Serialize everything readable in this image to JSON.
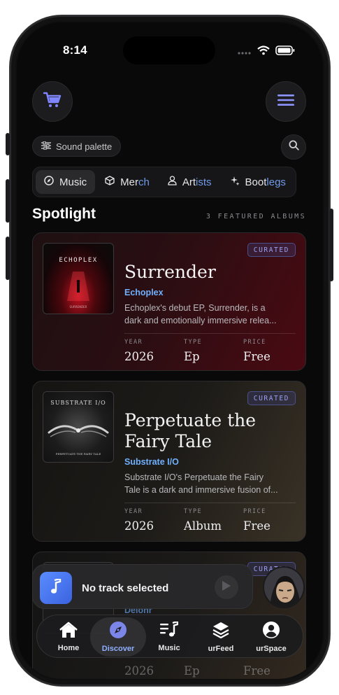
{
  "status": {
    "time": "8:14"
  },
  "header": {
    "cart_icon": "cart-icon",
    "menu_icon": "menu-icon"
  },
  "filter": {
    "label": "Sound palette",
    "search_icon": "search-icon"
  },
  "tabs": [
    {
      "name": "Music",
      "prefix": "Music",
      "suffix": "",
      "icon": "compass-icon",
      "active": true
    },
    {
      "name": "Merch",
      "prefix": "Mer",
      "suffix": "ch",
      "icon": "box-icon",
      "active": false
    },
    {
      "name": "Artists",
      "prefix": "Art",
      "suffix": "ists",
      "icon": "person-icon",
      "active": false
    },
    {
      "name": "Bootlegs",
      "prefix": "Boot",
      "suffix": "legs",
      "icon": "sparkle-icon",
      "active": false
    }
  ],
  "spotlight": {
    "title": "Spotlight",
    "meta": "3 FEATURED ALBUMS"
  },
  "albums": [
    {
      "badge": "CURATED",
      "title": "Surrender",
      "artist": "Echoplex",
      "desc_line1": "Echoplex's debut EP, Surrender, is a",
      "desc_line2": "dark and emotionally immersive relea...",
      "cover_text": "ECHOPLEX",
      "cover_sub": "SURRENDER",
      "year_label": "YEAR",
      "year": "2026",
      "type_label": "TYPE",
      "type": "Ep",
      "price_label": "PRICE",
      "price": "Free"
    },
    {
      "badge": "CURATED",
      "title_line1": "Perpetuate the",
      "title_line2": "Fairy Tale",
      "artist": "Substrate I/O",
      "desc_line1": "Substrate I/O's Perpetuate the Fairy",
      "desc_line2": "Tale is a dark and immersive fusion of...",
      "cover_text": "SUBSTRATE I/O",
      "cover_sub": "PERPETUATE THE FAIRY TALE",
      "year_label": "YEAR",
      "year": "2026",
      "type_label": "TYPE",
      "type": "Album",
      "price_label": "PRICE",
      "price": "Free"
    },
    {
      "badge": "CURATED",
      "artist": "Delonr",
      "year": "2026",
      "type": "Ep",
      "price": "Free"
    }
  ],
  "now_playing": {
    "text": "No track selected",
    "icon": "music-note-icon"
  },
  "tabbar": [
    {
      "label": "Home",
      "icon": "home-icon"
    },
    {
      "label": "Discover",
      "icon": "compass-icon",
      "active": true
    },
    {
      "label": "Music",
      "icon": "music-list-icon"
    },
    {
      "label": "urFeed",
      "icon": "layers-icon"
    },
    {
      "label": "urSpace",
      "icon": "user-circle-icon"
    }
  ],
  "colors": {
    "accent": "#6f9be8",
    "artist": "#6fb0ff",
    "badge": "#9aa0f0",
    "cart": "#7f86ff"
  }
}
